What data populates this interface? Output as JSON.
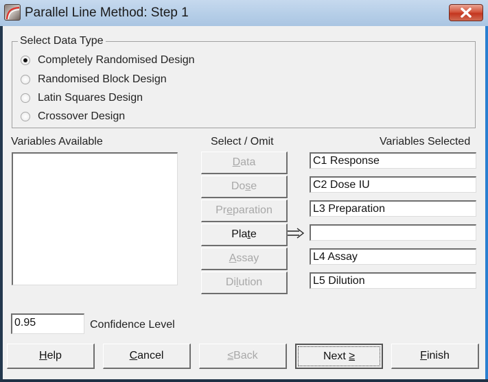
{
  "window": {
    "title": "Parallel Line Method: Step 1",
    "app_icon": "curve-chart-icon",
    "close_icon": "close-x-icon"
  },
  "data_type": {
    "legend": "Select Data Type",
    "options": [
      {
        "label": "Completely Randomised Design",
        "checked": true
      },
      {
        "label": "Randomised Block Design",
        "checked": false
      },
      {
        "label": "Latin Squares Design",
        "checked": false
      },
      {
        "label": "Crossover Design",
        "checked": false
      }
    ]
  },
  "variables_available": {
    "label": "Variables Available",
    "items": []
  },
  "select_omit": {
    "label": "Select / Omit",
    "arrow_icon": "double-arrow-right-icon",
    "buttons": [
      {
        "pre": "",
        "key": "D",
        "post": "ata",
        "enabled": false
      },
      {
        "pre": "Do",
        "key": "s",
        "post": "e",
        "enabled": false
      },
      {
        "pre": "Pr",
        "key": "e",
        "post": "paration",
        "enabled": false
      },
      {
        "pre": "Pla",
        "key": "t",
        "post": "e",
        "enabled": true
      },
      {
        "pre": "",
        "key": "A",
        "post": "ssay",
        "enabled": false
      },
      {
        "pre": "Di",
        "key": "l",
        "post": "ution",
        "enabled": false
      }
    ]
  },
  "variables_selected": {
    "label": "Variables Selected",
    "values": [
      "C1 Response",
      "C2 Dose IU",
      "L3 Preparation",
      "",
      "L4 Assay",
      "L5 Dilution"
    ]
  },
  "confidence": {
    "value": "0.95",
    "label": "Confidence Level"
  },
  "footer": {
    "help": {
      "pre": "",
      "key": "H",
      "post": "elp",
      "enabled": true
    },
    "cancel": {
      "pre": "",
      "key": "C",
      "post": "ancel",
      "enabled": true
    },
    "back": {
      "pre": "",
      "key": "≤",
      "post": " Back",
      "enabled": false
    },
    "next": {
      "pre": "Next ",
      "key": "≥",
      "post": "",
      "enabled": true
    },
    "finish": {
      "pre": "",
      "key": "F",
      "post": "inish",
      "enabled": true
    }
  }
}
